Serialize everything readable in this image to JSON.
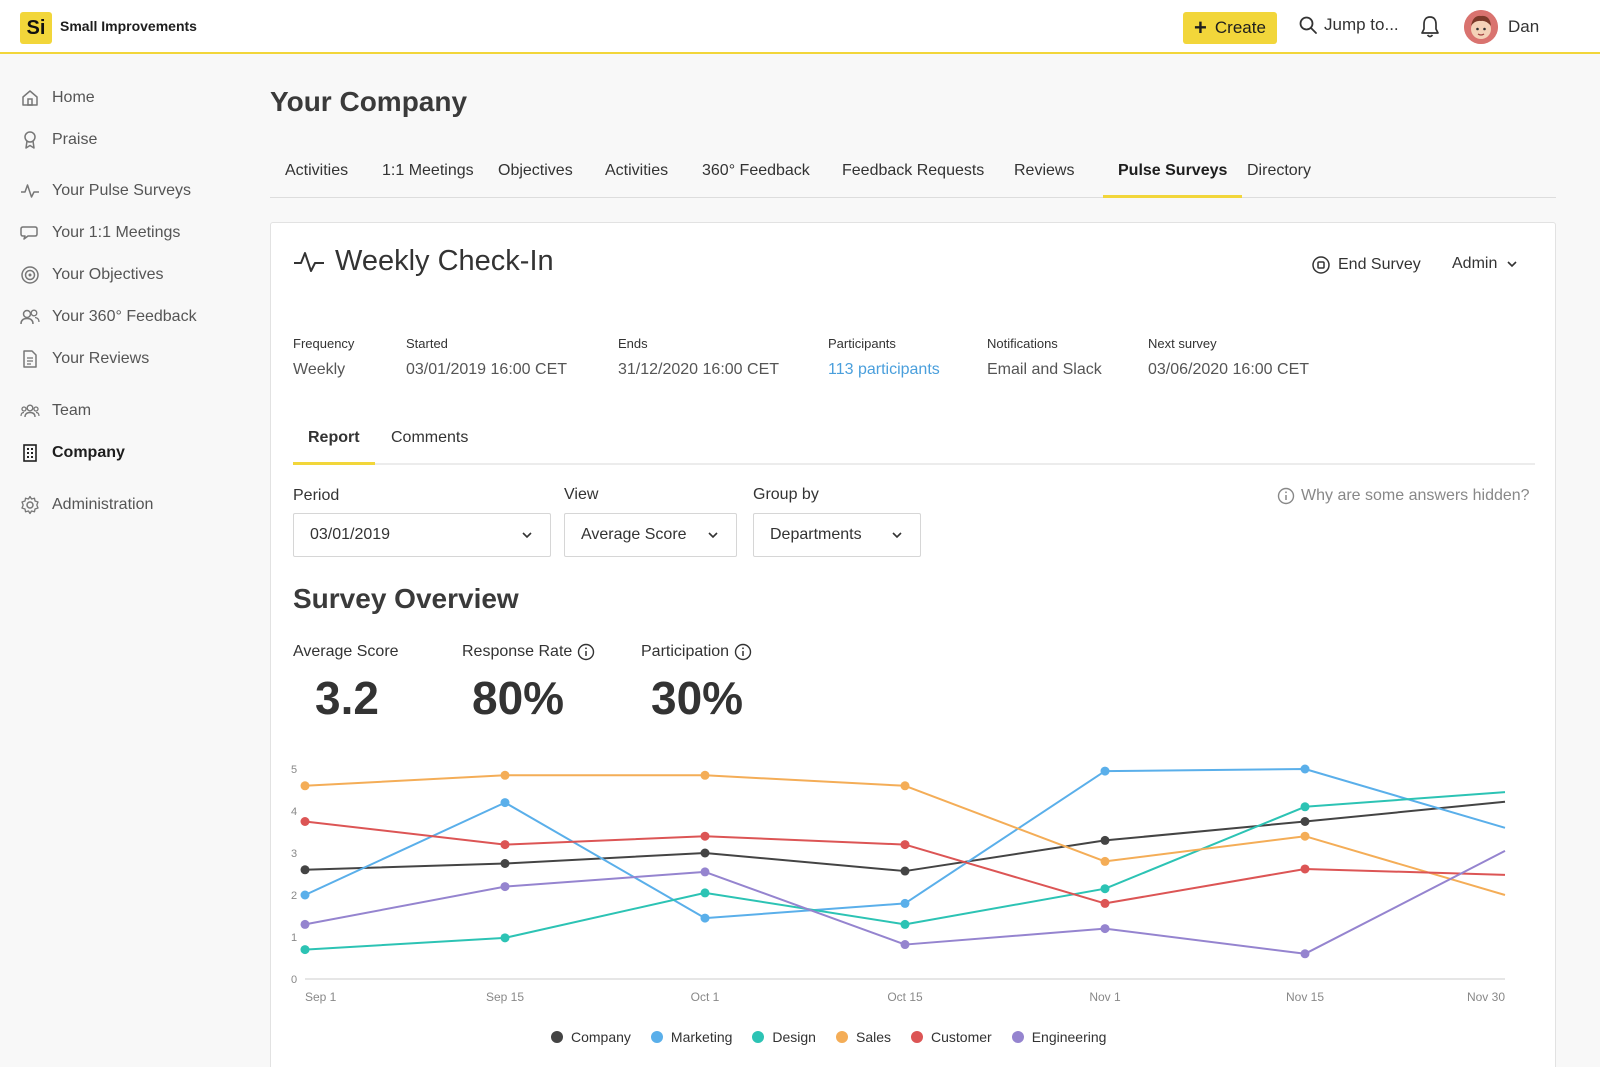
{
  "app": {
    "logo": "Si",
    "name": "Small Improvements"
  },
  "topbar": {
    "create_label": "Create",
    "jump_label": "Jump to...",
    "user_name": "Dan"
  },
  "sidebar": {
    "items": [
      {
        "label": "Home",
        "icon": "home-icon"
      },
      {
        "label": "Praise",
        "icon": "award-icon"
      },
      {
        "label": "Your Pulse Surveys",
        "icon": "pulse-icon"
      },
      {
        "label": "Your 1:1 Meetings",
        "icon": "chat-icon"
      },
      {
        "label": "Your Objectives",
        "icon": "target-icon"
      },
      {
        "label": "Your 360° Feedback",
        "icon": "people-icon"
      },
      {
        "label": "Your Reviews",
        "icon": "document-icon"
      },
      {
        "label": "Team",
        "icon": "team-icon"
      },
      {
        "label": "Company",
        "icon": "building-icon",
        "active": true
      },
      {
        "label": "Administration",
        "icon": "gear-icon"
      }
    ]
  },
  "page": {
    "title": "Your Company"
  },
  "tabs": [
    {
      "label": "Activities"
    },
    {
      "label": "1:1 Meetings"
    },
    {
      "label": "Objectives"
    },
    {
      "label": "Activities"
    },
    {
      "label": "360° Feedback"
    },
    {
      "label": "Feedback Requests"
    },
    {
      "label": "Reviews"
    },
    {
      "label": "Pulse Surveys",
      "active": true
    },
    {
      "label": "Directory"
    }
  ],
  "survey": {
    "title": "Weekly Check-In",
    "end_label": "End Survey",
    "admin_label": "Admin",
    "meta": {
      "frequency": {
        "label": "Frequency",
        "value": "Weekly"
      },
      "started": {
        "label": "Started",
        "value": "03/01/2019 16:00 CET"
      },
      "ends": {
        "label": "Ends",
        "value": "31/12/2020 16:00 CET"
      },
      "participants": {
        "label": "Participants",
        "value": "113 participants"
      },
      "notifications": {
        "label": "Notifications",
        "value": "Email and Slack"
      },
      "next": {
        "label": "Next survey",
        "value": "03/06/2020 16:00 CET"
      }
    },
    "subtabs": {
      "report": "Report",
      "comments": "Comments"
    },
    "filters": {
      "period": {
        "label": "Period",
        "value": "03/01/2019"
      },
      "view": {
        "label": "View",
        "value": "Average Score"
      },
      "group": {
        "label": "Group by",
        "value": "Departments"
      }
    },
    "hidden_link": "Why are some answers hidden?",
    "overview_title": "Survey Overview",
    "stats": {
      "avg": {
        "label": "Average Score",
        "value": "3.2"
      },
      "response": {
        "label": "Response Rate",
        "value": "80%"
      },
      "participation": {
        "label": "Participation",
        "value": "30%"
      }
    }
  },
  "chart_data": {
    "type": "line",
    "categories": [
      "Sep 1",
      "Sep 15",
      "Oct 1",
      "Oct 15",
      "Nov 1",
      "Nov 15",
      "Nov 30"
    ],
    "y_ticks": [
      "0",
      "1",
      "2",
      "3",
      "4",
      "5"
    ],
    "ylim": [
      0,
      5
    ],
    "grid": false,
    "legend_position": "bottom",
    "series": [
      {
        "name": "Company",
        "color": "#444444",
        "values": [
          2.6,
          2.75,
          3.0,
          2.57,
          3.3,
          3.75,
          4.22
        ]
      },
      {
        "name": "Marketing",
        "color": "#5aafea",
        "values": [
          2.0,
          4.2,
          1.45,
          1.8,
          4.95,
          5.0,
          3.6
        ]
      },
      {
        "name": "Design",
        "color": "#2cc3b4",
        "values": [
          0.7,
          0.98,
          2.05,
          1.3,
          2.15,
          4.1,
          4.45
        ]
      },
      {
        "name": "Sales",
        "color": "#f4ad57",
        "values": [
          4.6,
          4.85,
          4.85,
          4.6,
          2.8,
          3.4,
          2.0
        ]
      },
      {
        "name": "Customer",
        "color": "#dc5555",
        "values": [
          3.75,
          3.2,
          3.4,
          3.2,
          1.8,
          2.62,
          2.48
        ]
      },
      {
        "name": "Engineering",
        "color": "#9584cf",
        "values": [
          1.3,
          2.2,
          2.55,
          0.82,
          1.2,
          0.6,
          3.05
        ]
      }
    ]
  }
}
